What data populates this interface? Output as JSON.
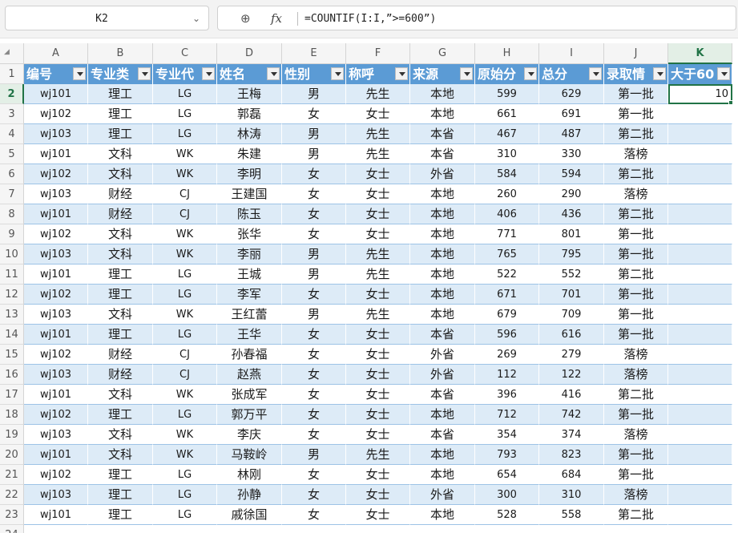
{
  "formula_bar": {
    "name_box": "K2",
    "formula": "=COUNTIF(I:I,”>=600”)",
    "zoom_icon": "zoom-icon",
    "fx_label": "fx"
  },
  "columns": [
    "A",
    "B",
    "C",
    "D",
    "E",
    "F",
    "G",
    "H",
    "I",
    "J",
    "K"
  ],
  "selected_column": "K",
  "row_numbers": [
    "1",
    "2",
    "3",
    "4",
    "5",
    "6",
    "7",
    "8",
    "9",
    "10",
    "11",
    "12",
    "13",
    "14",
    "15",
    "16",
    "17",
    "18",
    "19",
    "20",
    "21",
    "22",
    "23",
    "24"
  ],
  "selected_row": "2",
  "headers": [
    "编号",
    "专业类",
    "专业代",
    "姓名",
    "性别",
    "称呼",
    "来源",
    "原始分",
    "总分",
    "录取情",
    "大于60"
  ],
  "header_colors": {
    "fill": "#5b9bd5",
    "band": "#ddebf7",
    "selection": "#217346"
  },
  "rows": [
    [
      "wj101",
      "理工",
      "LG",
      "王梅",
      "男",
      "先生",
      "本地",
      "599",
      "629",
      "第一批",
      "10"
    ],
    [
      "wj102",
      "理工",
      "LG",
      "郭磊",
      "女",
      "女士",
      "本地",
      "661",
      "691",
      "第一批",
      ""
    ],
    [
      "wj103",
      "理工",
      "LG",
      "林涛",
      "男",
      "先生",
      "本省",
      "467",
      "487",
      "第二批",
      ""
    ],
    [
      "wj101",
      "文科",
      "WK",
      "朱建",
      "男",
      "先生",
      "本省",
      "310",
      "330",
      "落榜",
      ""
    ],
    [
      "wj102",
      "文科",
      "WK",
      "李明",
      "女",
      "女士",
      "外省",
      "584",
      "594",
      "第二批",
      ""
    ],
    [
      "wj103",
      "财经",
      "CJ",
      "王建国",
      "女",
      "女士",
      "本地",
      "260",
      "290",
      "落榜",
      ""
    ],
    [
      "wj101",
      "财经",
      "CJ",
      "陈玉",
      "女",
      "女士",
      "本地",
      "406",
      "436",
      "第二批",
      ""
    ],
    [
      "wj102",
      "文科",
      "WK",
      "张华",
      "女",
      "女士",
      "本地",
      "771",
      "801",
      "第一批",
      ""
    ],
    [
      "wj103",
      "文科",
      "WK",
      "李丽",
      "男",
      "先生",
      "本地",
      "765",
      "795",
      "第一批",
      ""
    ],
    [
      "wj101",
      "理工",
      "LG",
      "王城",
      "男",
      "先生",
      "本地",
      "522",
      "552",
      "第二批",
      ""
    ],
    [
      "wj102",
      "理工",
      "LG",
      "李军",
      "女",
      "女士",
      "本地",
      "671",
      "701",
      "第一批",
      ""
    ],
    [
      "wj103",
      "文科",
      "WK",
      "王红蕾",
      "男",
      "先生",
      "本地",
      "679",
      "709",
      "第一批",
      ""
    ],
    [
      "wj101",
      "理工",
      "LG",
      "王华",
      "女",
      "女士",
      "本省",
      "596",
      "616",
      "第一批",
      ""
    ],
    [
      "wj102",
      "财经",
      "CJ",
      "孙春福",
      "女",
      "女士",
      "外省",
      "269",
      "279",
      "落榜",
      ""
    ],
    [
      "wj103",
      "财经",
      "CJ",
      "赵燕",
      "女",
      "女士",
      "外省",
      "112",
      "122",
      "落榜",
      ""
    ],
    [
      "wj101",
      "文科",
      "WK",
      "张成军",
      "女",
      "女士",
      "本省",
      "396",
      "416",
      "第二批",
      ""
    ],
    [
      "wj102",
      "理工",
      "LG",
      "郭万平",
      "女",
      "女士",
      "本地",
      "712",
      "742",
      "第一批",
      ""
    ],
    [
      "wj103",
      "文科",
      "WK",
      "李庆",
      "女",
      "女士",
      "本省",
      "354",
      "374",
      "落榜",
      ""
    ],
    [
      "wj101",
      "文科",
      "WK",
      "马鞍岭",
      "男",
      "先生",
      "本地",
      "793",
      "823",
      "第一批",
      ""
    ],
    [
      "wj102",
      "理工",
      "LG",
      "林刚",
      "女",
      "女士",
      "本地",
      "654",
      "684",
      "第一批",
      ""
    ],
    [
      "wj103",
      "理工",
      "LG",
      "孙静",
      "女",
      "女士",
      "外省",
      "300",
      "310",
      "落榜",
      ""
    ],
    [
      "wj101",
      "理工",
      "LG",
      "戚徐国",
      "女",
      "女士",
      "本地",
      "528",
      "558",
      "第二批",
      ""
    ]
  ]
}
